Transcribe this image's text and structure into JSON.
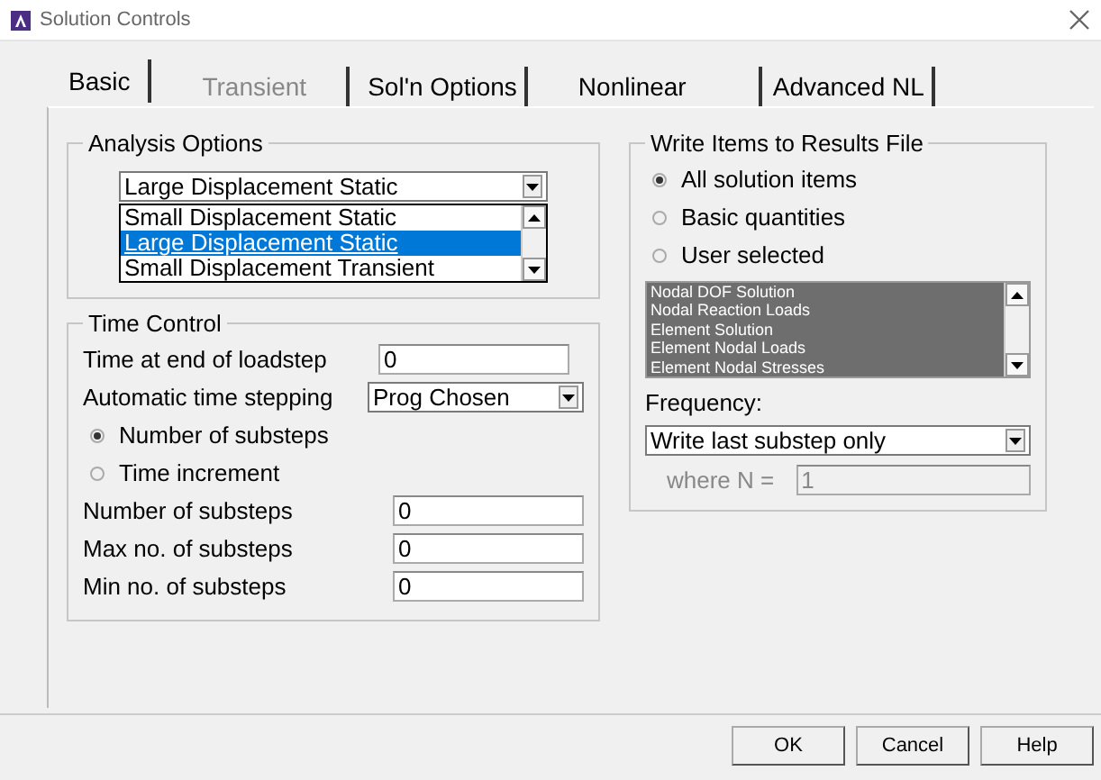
{
  "window": {
    "title": "Solution Controls"
  },
  "tabs": [
    {
      "label": "Basic",
      "selected": true,
      "disabled": false
    },
    {
      "label": "Transient",
      "selected": false,
      "disabled": true
    },
    {
      "label": "Sol'n Options",
      "selected": false,
      "disabled": false
    },
    {
      "label": "Nonlinear",
      "selected": false,
      "disabled": false
    },
    {
      "label": "Advanced NL",
      "selected": false,
      "disabled": false
    }
  ],
  "analysis_options": {
    "title": "Analysis Options",
    "value": "Large Displacement Static",
    "list": [
      {
        "label": "Small Displacement Static",
        "selected": false
      },
      {
        "label": "Large Displacement Static",
        "selected": true
      },
      {
        "label": "Small Displacement Transient",
        "selected": false
      }
    ]
  },
  "time_control": {
    "title": "Time Control",
    "time_at_end": {
      "label": "Time at end of loadstep",
      "value": "0"
    },
    "auto_stepping": {
      "label": "Automatic time stepping",
      "value": "Prog Chosen"
    },
    "mode": [
      {
        "label": "Number of substeps",
        "selected": true
      },
      {
        "label": "Time increment",
        "selected": false
      }
    ],
    "fields": [
      {
        "label": "Number of substeps",
        "value": "0"
      },
      {
        "label": "Max no. of substeps",
        "value": "0"
      },
      {
        "label": "Min no. of substeps",
        "value": "0"
      }
    ]
  },
  "write_items": {
    "title": "Write Items to Results File",
    "options": [
      {
        "label": "All solution items",
        "selected": true
      },
      {
        "label": "Basic quantities",
        "selected": false
      },
      {
        "label": "User selected",
        "selected": false
      }
    ],
    "items": [
      {
        "label": "Nodal DOF Solution",
        "selected": true
      },
      {
        "label": "Nodal Reaction Loads",
        "selected": true
      },
      {
        "label": "Element Solution",
        "selected": true
      },
      {
        "label": "Element Nodal Loads",
        "selected": true
      },
      {
        "label": "Element Nodal Stresses",
        "selected": true
      }
    ],
    "frequency_label": "Frequency:",
    "frequency": "Write last substep only",
    "where_n": {
      "label": "where N =",
      "value": "1",
      "disabled": true
    }
  },
  "buttons": [
    "OK",
    "Cancel",
    "Help"
  ]
}
